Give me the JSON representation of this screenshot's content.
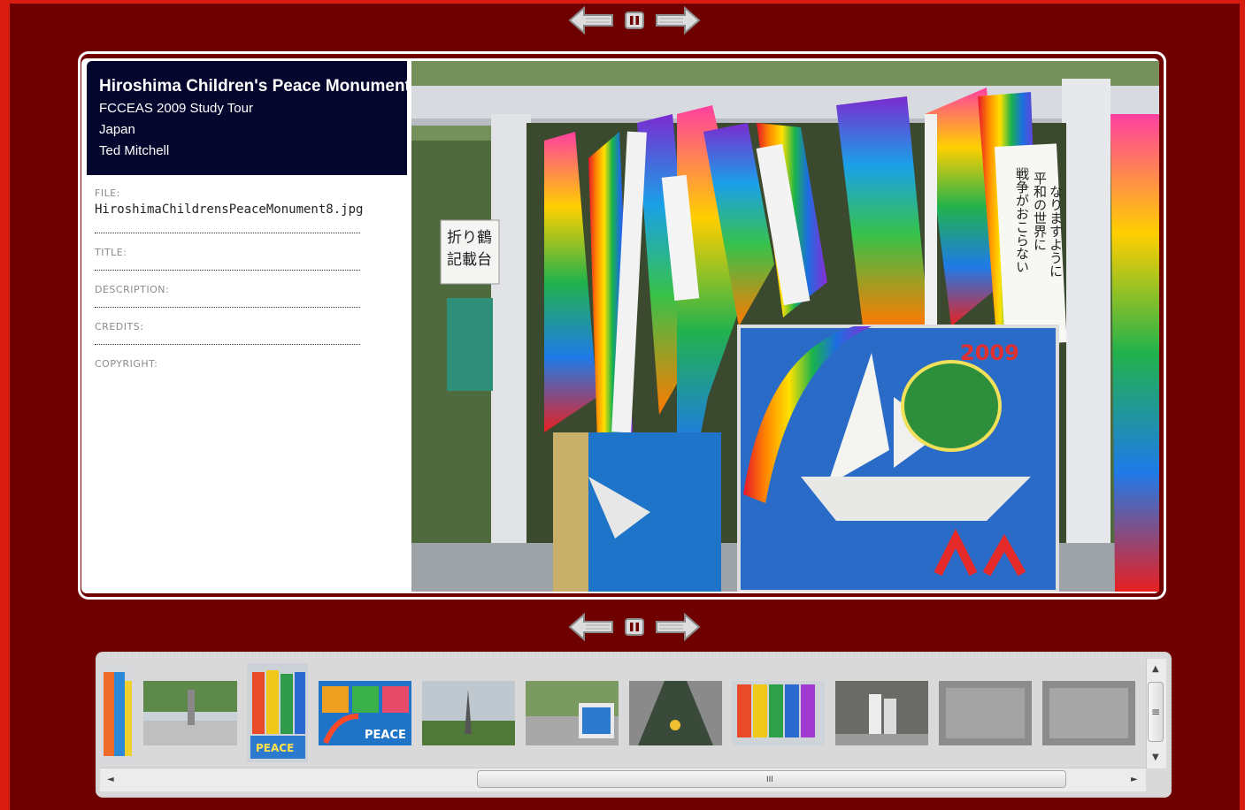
{
  "caption": {
    "title": "Hiroshima Children's Peace Monument",
    "lines": [
      "FCCEAS 2009 Study Tour",
      "Japan",
      "Ted Mitchell"
    ]
  },
  "metadata": {
    "file_label": "FILE:",
    "file_value": "HiroshimaChildrensPeaceMonument8.jpg",
    "title_label": "TITLE:",
    "description_label": "DESCRIPTION:",
    "credits_label": "CREDITS:",
    "copyright_label": "COPYRIGHT:"
  },
  "photo_sign": {
    "line1": "折り鶴",
    "line2": "記載台",
    "vertical": [
      "戦争がおこらない",
      "平和の世界に",
      "なりますように"
    ],
    "year": "2009"
  },
  "thumbnails": {
    "peace_label": "PEACE",
    "items": [
      "thumbnail-1",
      "thumbnail-2",
      "thumbnail-3",
      "thumbnail-4",
      "thumbnail-5",
      "thumbnail-6",
      "thumbnail-7",
      "thumbnail-8",
      "thumbnail-9",
      "thumbnail-10",
      "thumbnail-11",
      "thumbnail-12"
    ]
  },
  "scrollbar": {
    "grip": "III",
    "left_arrow": "◄",
    "right_arrow": "►",
    "up_arrow": "▲",
    "down_arrow": "▼",
    "v_grip": "≡"
  },
  "colors": {
    "background": "#6e0000",
    "frame": "#d81d10",
    "caption_bg": "#05062e"
  }
}
